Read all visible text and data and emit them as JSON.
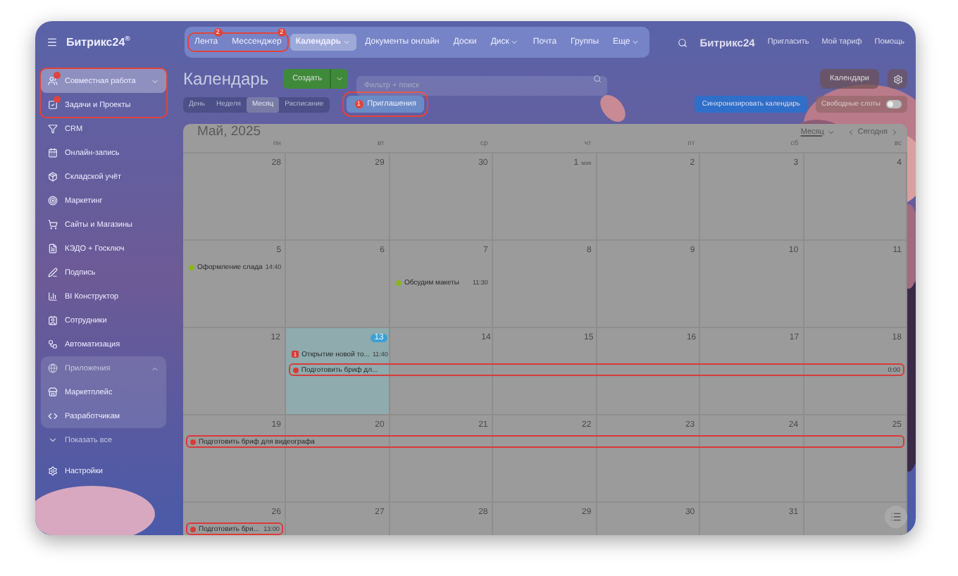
{
  "topbar": {
    "logo": "Битрикс24",
    "logo_mark": "®",
    "nav": [
      {
        "label": "Лента",
        "badge": "2",
        "selected": false,
        "caret": false,
        "highlighted": true
      },
      {
        "label": "Мессенджер",
        "badge": "2",
        "selected": false,
        "caret": false,
        "highlighted": true
      },
      {
        "label": "Календарь",
        "selected": true,
        "caret": true,
        "highlighted": false
      },
      {
        "label": "Документы онлайн",
        "selected": false,
        "caret": false,
        "highlighted": false
      },
      {
        "label": "Доски",
        "selected": false,
        "caret": false,
        "highlighted": false
      },
      {
        "label": "Диск",
        "selected": false,
        "caret": true,
        "highlighted": false
      },
      {
        "label": "Почта",
        "selected": false,
        "caret": false,
        "highlighted": false
      },
      {
        "label": "Группы",
        "selected": false,
        "caret": false,
        "highlighted": false
      },
      {
        "label": "Еще",
        "selected": false,
        "caret": true,
        "highlighted": false
      }
    ],
    "portal": "Битрикс24",
    "links": [
      "Пригласить",
      "Мой тариф",
      "Помощь"
    ]
  },
  "sidebar": {
    "items": [
      {
        "kind": "item",
        "label": "Совместная работа",
        "badge": true,
        "selected": true,
        "caret": true,
        "highlighted": true
      },
      {
        "kind": "item",
        "label": "Задачи и Проекты",
        "badge": true,
        "selected": false,
        "caret": false,
        "highlighted": true
      },
      {
        "kind": "item",
        "label": "CRM",
        "badge": false,
        "selected": false,
        "caret": false,
        "highlighted": false
      },
      {
        "kind": "item",
        "label": "Онлайн-запись",
        "badge": false,
        "selected": false,
        "caret": false,
        "highlighted": false
      },
      {
        "kind": "item",
        "label": "Складской учёт",
        "badge": false,
        "selected": false,
        "caret": false,
        "highlighted": false
      },
      {
        "kind": "item",
        "label": "Маркетинг",
        "badge": false,
        "selected": false,
        "caret": false,
        "highlighted": false
      },
      {
        "kind": "item",
        "label": "Сайты и Магазины",
        "badge": false,
        "selected": false,
        "caret": false,
        "highlighted": false
      },
      {
        "kind": "item",
        "label": "КЭДО + Госключ",
        "badge": false,
        "selected": false,
        "caret": false,
        "highlighted": false
      },
      {
        "kind": "item",
        "label": "Подпись",
        "badge": false,
        "selected": false,
        "caret": false,
        "highlighted": false
      },
      {
        "kind": "item",
        "label": "BI Конструктор",
        "badge": false,
        "selected": false,
        "caret": false,
        "highlighted": false
      },
      {
        "kind": "item",
        "label": "Сотрудники",
        "badge": false,
        "selected": false,
        "caret": false,
        "highlighted": false
      },
      {
        "kind": "item",
        "label": "Автоматизация",
        "badge": false,
        "selected": false,
        "caret": false,
        "highlighted": false
      },
      {
        "kind": "group",
        "label": "Приложения",
        "expanded": true,
        "children": [
          {
            "label": "Маркетплейс"
          },
          {
            "label": "Разработчикам"
          }
        ]
      },
      {
        "kind": "more",
        "label": "Показать все"
      }
    ],
    "footer": "Настройки"
  },
  "page": {
    "title": "Календарь",
    "create_button": "Создать",
    "filter": {
      "placeholder": "Фильтр + поиск"
    },
    "calendars_button": "Календари",
    "view_tabs": [
      {
        "label": "День",
        "selected": false
      },
      {
        "label": "Неделя",
        "selected": false
      },
      {
        "label": "Месяц",
        "selected": true
      },
      {
        "label": "Расписание",
        "selected": false
      }
    ],
    "invites": {
      "label": "Приглашения",
      "badge": "1",
      "highlighted": true
    },
    "sync_button": "Синхронизировать календарь",
    "free_slots": {
      "label": "Свободные слоты",
      "on": false
    }
  },
  "calendar": {
    "month": "Май",
    "year": ", 2025",
    "view_select": "Месяц",
    "today_button": "Сегодня",
    "weekdays": [
      "пн",
      "вт",
      "ср",
      "чт",
      "пт",
      "сб",
      "вс"
    ],
    "weeks": [
      {
        "days": [
          {
            "label": "28",
            "today": false
          },
          {
            "label": "29",
            "today": false
          },
          {
            "label": "30",
            "today": false
          },
          {
            "label": "1",
            "month": "мая",
            "today": false
          },
          {
            "label": "2",
            "today": false
          },
          {
            "label": "3",
            "today": false
          },
          {
            "label": "4",
            "today": false
          }
        ]
      },
      {
        "days": [
          {
            "label": "5",
            "today": false,
            "events": [
              {
                "kind": "dot",
                "title": "Оформление слада",
                "time": "14:40",
                "color": "#8ab51e"
              }
            ]
          },
          {
            "label": "6",
            "today": false
          },
          {
            "label": "7",
            "today": false,
            "events": [
              {
                "kind": "dot",
                "title": "Обсудим макеты",
                "time": "11:30",
                "color": "#8ab51e"
              }
            ]
          },
          {
            "label": "8",
            "today": false
          },
          {
            "label": "9",
            "today": false
          },
          {
            "label": "10",
            "today": false
          },
          {
            "label": "11",
            "today": false
          }
        ]
      },
      {
        "days": [
          {
            "label": "12",
            "today": false
          },
          {
            "label": "13",
            "today": true,
            "events": [
              {
                "kind": "dot",
                "title": "Открытие новой то...",
                "time": "11:40",
                "badge": "1",
                "color": "#d93a3a"
              },
              {
                "kind": "bar",
                "title": "Подготовить бриф дл...",
                "time": "0:00",
                "color": "#d93a3a"
              }
            ]
          },
          {
            "label": "14",
            "today": false
          },
          {
            "label": "15",
            "today": false
          },
          {
            "label": "16",
            "today": false
          },
          {
            "label": "17",
            "today": false
          },
          {
            "label": "18",
            "today": false
          }
        ]
      },
      {
        "days": [
          {
            "label": "19",
            "today": false,
            "events": [
              {
                "kind": "bar",
                "title": "Подготовить бриф для видеографа",
                "color": "#d93a3a"
              }
            ]
          },
          {
            "label": "20",
            "today": false
          },
          {
            "label": "21",
            "today": false
          },
          {
            "label": "22",
            "today": false
          },
          {
            "label": "23",
            "today": false
          },
          {
            "label": "24",
            "today": false
          },
          {
            "label": "25",
            "today": false
          }
        ]
      },
      {
        "days": [
          {
            "label": "26",
            "today": false,
            "events": [
              {
                "kind": "chip",
                "title": "Подготовить бри...",
                "time": "13:00",
                "color": "#d93a3a"
              }
            ]
          },
          {
            "label": "27",
            "today": false
          },
          {
            "label": "28",
            "today": false
          },
          {
            "label": "29",
            "today": false
          },
          {
            "label": "30",
            "today": false
          },
          {
            "label": "31",
            "today": false
          }
        ]
      }
    ]
  }
}
